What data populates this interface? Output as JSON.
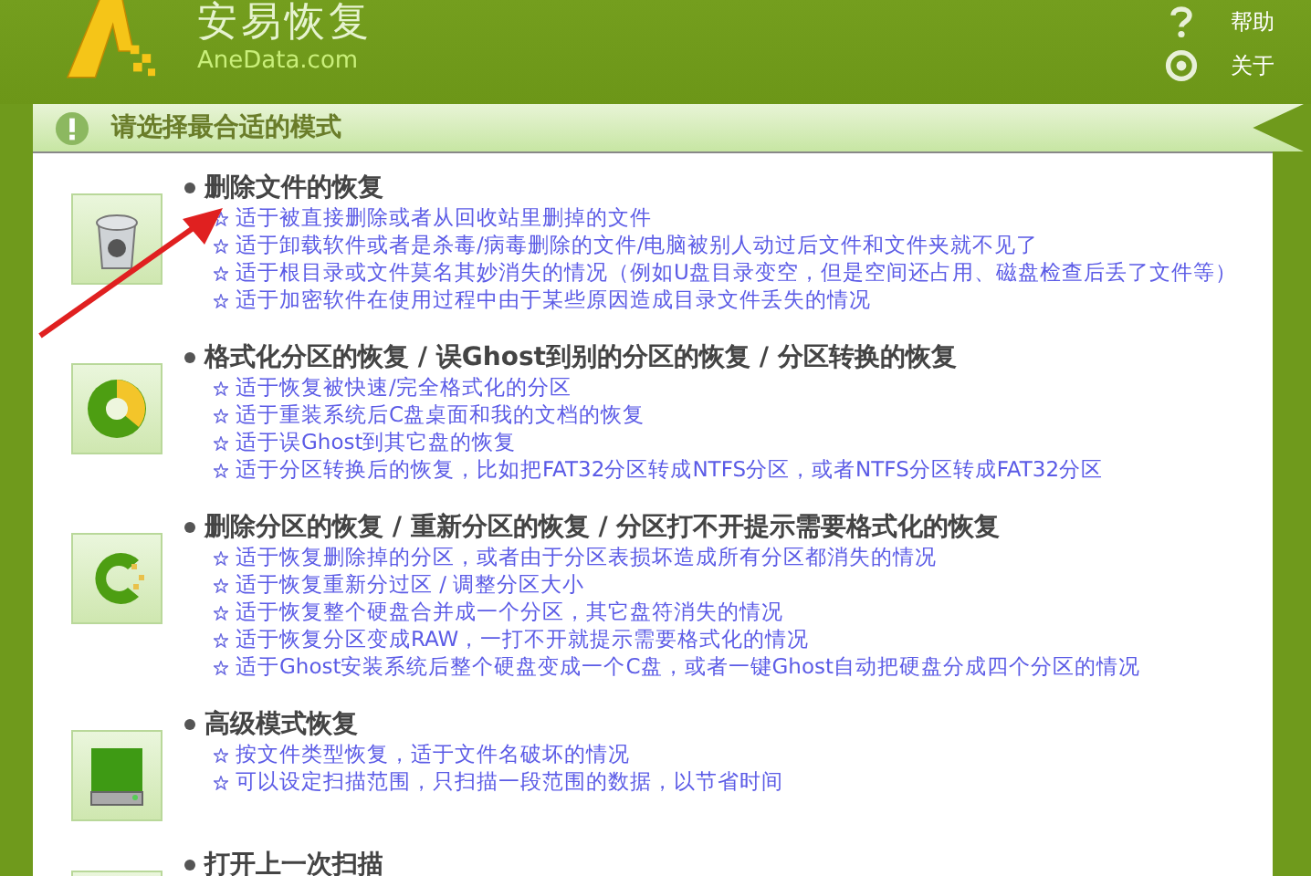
{
  "app": {
    "name": "安易恢复",
    "domain": "AneData.com"
  },
  "header_links": [
    {
      "label": "帮助",
      "kind": "help"
    },
    {
      "label": "关于",
      "kind": "about"
    }
  ],
  "panel": {
    "title": "请选择最合适的模式"
  },
  "modes": [
    {
      "kind": "trash",
      "title": "删除文件的恢复",
      "items": [
        "适于被直接删除或者从回收站里删掉的文件",
        "适于卸载软件或者是杀毒/病毒删除的文件/电脑被别人动过后文件和文件夹就不见了",
        "适于根目录或文件莫名其妙消失的情况（例如U盘目录变空，但是空间还占用、磁盘检查后丢了文件等）",
        "适于加密软件在使用过程中由于某些原因造成目录文件丢失的情况"
      ]
    },
    {
      "kind": "format",
      "title": "格式化分区的恢复 / 误Ghost到别的分区的恢复 / 分区转换的恢复",
      "items": [
        "适于恢复被快速/完全格式化的分区",
        "适于重装系统后C盘桌面和我的文档的恢复",
        "适于误Ghost到其它盘的恢复",
        "适于分区转换后的恢复，比如把FAT32分区转成NTFS分区，或者NTFS分区转成FAT32分区"
      ]
    },
    {
      "kind": "partition",
      "title": "删除分区的恢复 / 重新分区的恢复 / 分区打不开提示需要格式化的恢复",
      "items": [
        "适于恢复删除掉的分区，或者由于分区表损坏造成所有分区都消失的情况",
        "适于恢复重新分过区 / 调整分区大小",
        "适于恢复整个硬盘合并成一个分区，其它盘符消失的情况",
        "适于恢复分区变成RAW，一打不开就提示需要格式化的情况",
        "适于Ghost安装系统后整个硬盘变成一个C盘，或者一键Ghost自动把硬盘分成四个分区的情况"
      ]
    },
    {
      "kind": "disk",
      "title": "高级模式恢复",
      "items": [
        "按文件类型恢复，适于文件名破坏的情况",
        "可以设定扫描范围，只扫描一段范围的数据，以节省时间"
      ]
    },
    {
      "kind": "reopen",
      "title": "打开上一次扫描"
    }
  ]
}
